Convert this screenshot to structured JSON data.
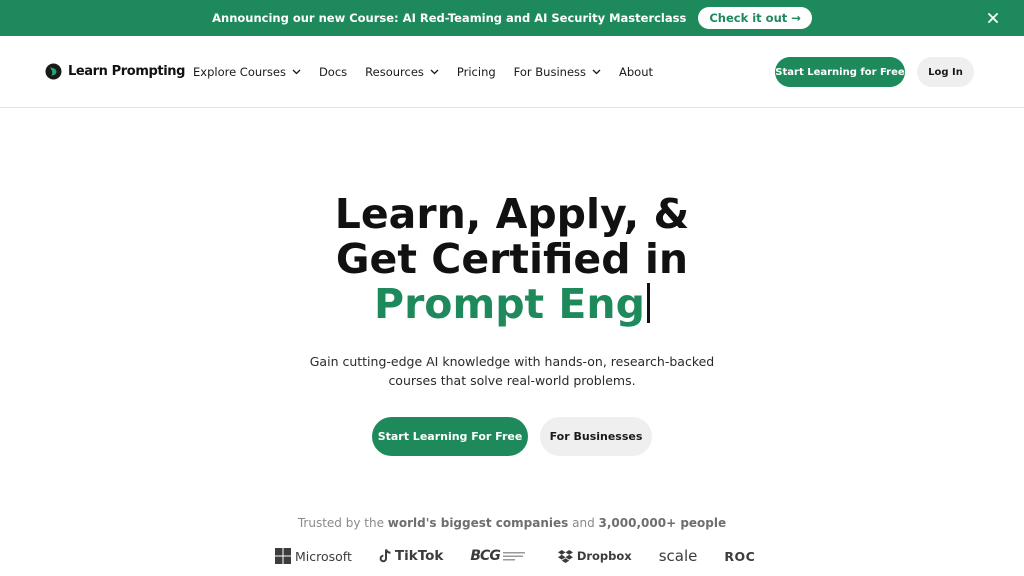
{
  "announcement": {
    "text": "Announcing our new Course: AI Red-Teaming and AI Security Masterclass",
    "cta": "Check it out →",
    "close_icon": "close-icon"
  },
  "brand": {
    "name": "Learn Prompting",
    "accent_color": "#1e8a5c"
  },
  "nav": {
    "items": [
      {
        "label": "Explore Courses",
        "dropdown": true
      },
      {
        "label": "Docs",
        "dropdown": false
      },
      {
        "label": "Resources",
        "dropdown": true
      },
      {
        "label": "Pricing",
        "dropdown": false
      },
      {
        "label": "For Business",
        "dropdown": true
      },
      {
        "label": "About",
        "dropdown": false
      }
    ],
    "start_label": "Start Learning for Free",
    "login_label": "Log In"
  },
  "hero": {
    "title_line1": "Learn, Apply, &",
    "title_line2": "Get Certified in",
    "title_typed": "Prompt Eng",
    "subtitle_line1": "Gain cutting-edge AI knowledge with hands-on, research-backed",
    "subtitle_line2": "courses that solve real-world problems.",
    "primary_cta": "Start Learning For Free",
    "secondary_cta": "For Businesses"
  },
  "trusted": {
    "prefix": "Trusted by the ",
    "highlight1": "world's biggest companies",
    "middle": " and ",
    "highlight2": "3,000,000+ people"
  },
  "companies": [
    "Microsoft",
    "TikTok",
    "BCG",
    "Dropbox",
    "scale",
    "ROCKI"
  ]
}
